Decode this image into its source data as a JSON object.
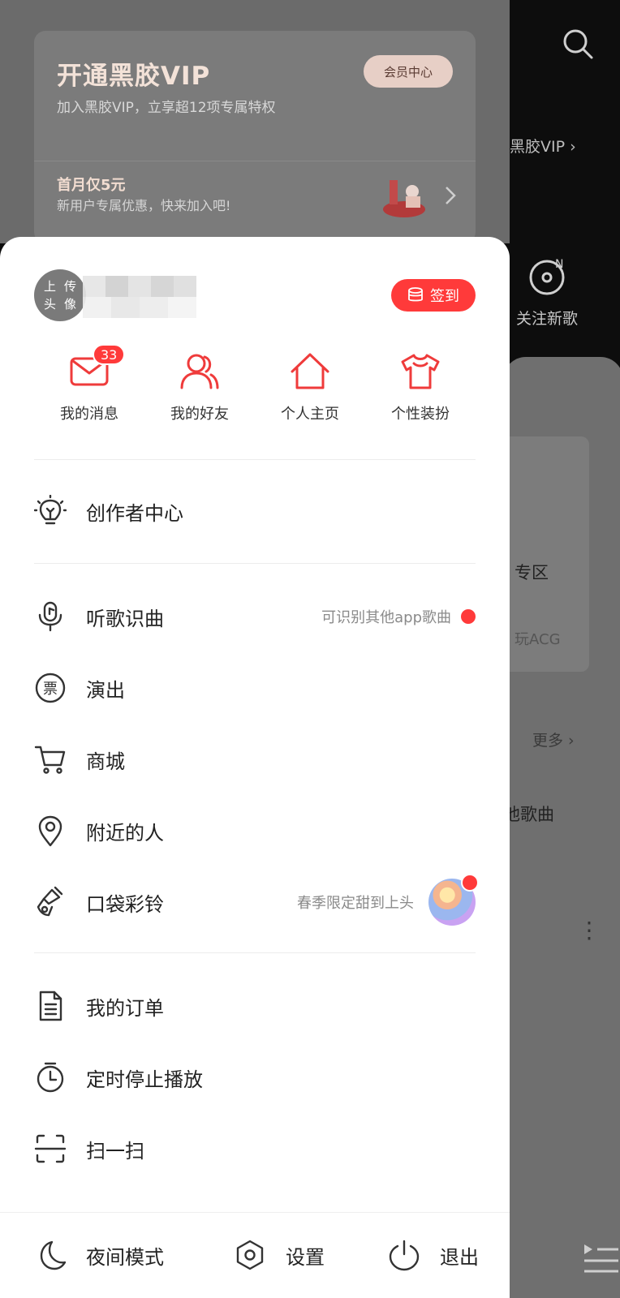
{
  "vip": {
    "title": "开通黑胶VIP",
    "subtitle": "加入黑胶VIP，立享超12项专属特权",
    "center_button": "会员中心",
    "promo_title": "首月仅5元",
    "promo_subtitle": "新用户专属优惠，快来加入吧!"
  },
  "user": {
    "avatar_line1": "上传",
    "avatar_line2": "头像",
    "signin_label": "签到"
  },
  "quick": [
    {
      "label": "我的消息",
      "badge": "33",
      "icon": "mail-icon"
    },
    {
      "label": "我的好友",
      "icon": "friends-icon"
    },
    {
      "label": "个人主页",
      "icon": "home-icon"
    },
    {
      "label": "个性装扮",
      "icon": "tshirt-icon"
    }
  ],
  "menu": {
    "creator": "创作者中心",
    "recognize": "听歌识曲",
    "recognize_note": "可识别其他app歌曲",
    "shows": "演出",
    "mall": "商城",
    "nearby": "附近的人",
    "ringtone": "口袋彩铃",
    "ringtone_note": "春季限定甜到上头",
    "orders": "我的订单",
    "timer": "定时停止播放",
    "scan": "扫一扫"
  },
  "bottom": {
    "night": "夜间模式",
    "settings": "设置",
    "logout": "退出"
  },
  "background": {
    "vip_link": "黑胶VIP",
    "new_song": "关注新歌",
    "zone": "专区",
    "acg": "玩ACG",
    "more": "更多",
    "other_songs": "他歌曲"
  },
  "colors": {
    "accent": "#ff3a3a",
    "icon_red": "#ef3b3b"
  }
}
